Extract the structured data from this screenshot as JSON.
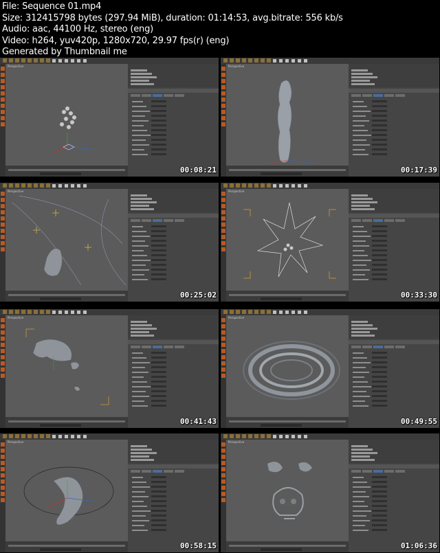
{
  "header": {
    "file": "File: Sequence 01.mp4",
    "size": "Size: 312415798 bytes (297.94 MiB), duration: 01:14:53, avg.bitrate: 556 kb/s",
    "audio": "Audio: aac, 44100 Hz, stereo (eng)",
    "video": "Video: h264, yuv420p, 1280x720, 29.97 fps(r) (eng)",
    "generator": "Generated by Thumbnail me"
  },
  "thumbnails": [
    {
      "timestamp": "00:08:21",
      "viewport_label": "Perspective"
    },
    {
      "timestamp": "00:17:39",
      "viewport_label": "Perspective"
    },
    {
      "timestamp": "00:25:02",
      "viewport_label": "Perspective"
    },
    {
      "timestamp": "00:33:30",
      "viewport_label": "Perspective"
    },
    {
      "timestamp": "00:41:43",
      "viewport_label": "Perspective"
    },
    {
      "timestamp": "00:49:55",
      "viewport_label": "Perspective"
    },
    {
      "timestamp": "00:58:15",
      "viewport_label": "Perspective"
    },
    {
      "timestamp": "01:06:36",
      "viewport_label": "Perspective"
    }
  ],
  "colors": {
    "background": "#000000",
    "ui_dark": "#3a3a3a",
    "viewport": "#5b5b5b",
    "accent_orange": "#b85a25",
    "selection_blue": "#4b6d99"
  }
}
